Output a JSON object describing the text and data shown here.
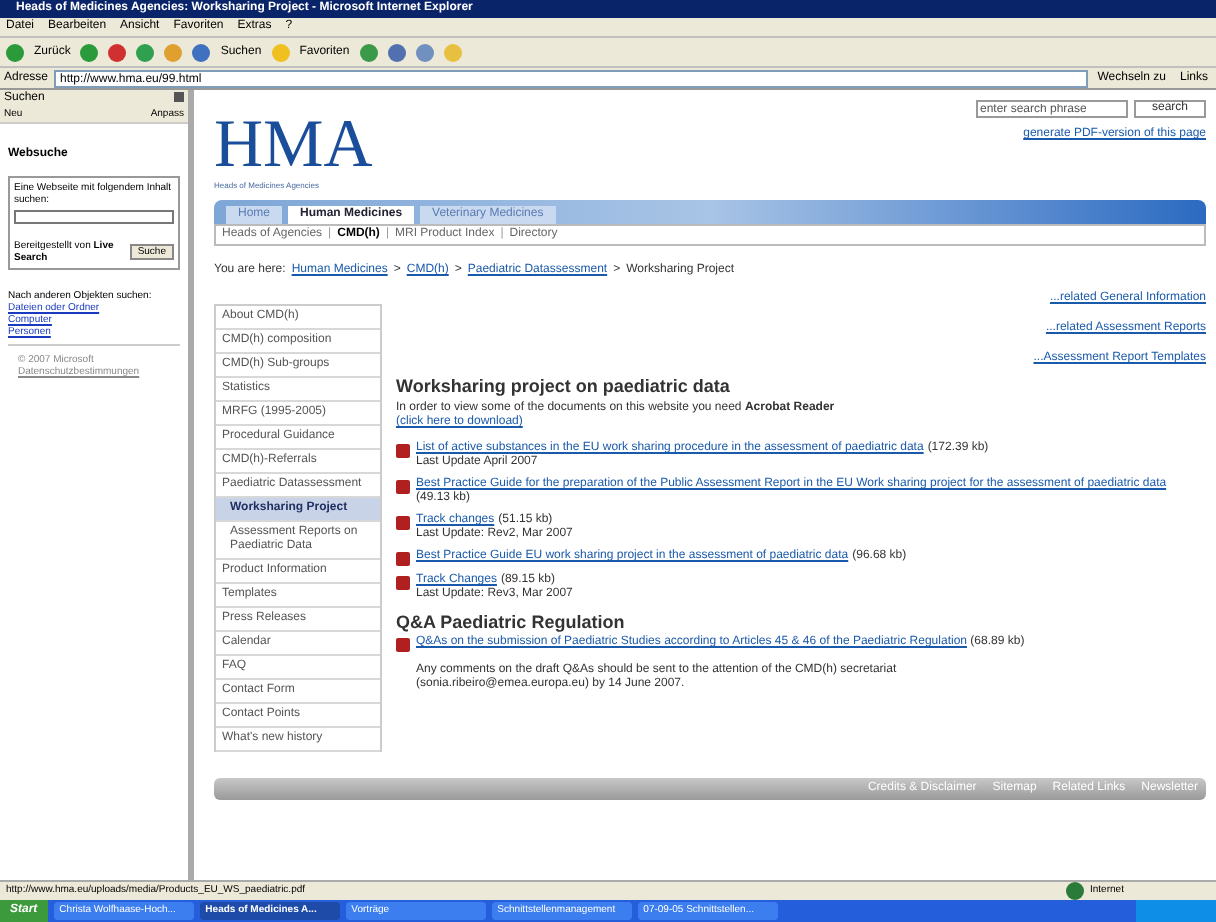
{
  "window": {
    "title": "Heads of Medicines Agencies: Worksharing Project - Microsoft Internet Explorer"
  },
  "menu": [
    "Datei",
    "Bearbeiten",
    "Ansicht",
    "Favoriten",
    "Extras",
    "?"
  ],
  "toolbar": {
    "back": "Zurück",
    "search": "Suchen",
    "favorites": "Favoriten"
  },
  "address": {
    "label": "Adresse",
    "url": "http://www.hma.eu/99.html",
    "go": "Wechseln zu",
    "links": "Links"
  },
  "search_pane": {
    "title": "Suchen",
    "new": "Neu",
    "customize": "Anpass",
    "heading": "Websuche",
    "prompt": "Eine Webseite mit folgendem Inhalt suchen:",
    "provider": "Bereitgestellt von **Live Search**",
    "button": "Suche",
    "other": "Nach anderen Objekten suchen:",
    "links": [
      "Dateien oder Ordner",
      "Computer",
      "Personen"
    ],
    "copyright": "© 2007 Microsoft",
    "privacy": "Datenschutzbestimmungen"
  },
  "page": {
    "logo": "HMA",
    "logo_sub": "Heads of Medicines Agencies",
    "search_placeholder": "enter search phrase",
    "search_button": "search",
    "pdf_link": "generate PDF-version of this page",
    "tabs": [
      {
        "label": "Home",
        "selected": false
      },
      {
        "label": "Human Medicines",
        "selected": true
      },
      {
        "label": "Veterinary Medicines",
        "selected": false
      }
    ],
    "subnav": [
      {
        "label": "Heads of Agencies",
        "selected": false
      },
      {
        "label": "CMD(h)",
        "selected": true
      },
      {
        "label": "MRI Product Index",
        "selected": false
      },
      {
        "label": "Directory",
        "selected": false
      }
    ],
    "subnav_separator": "|",
    "breadcrumb_separator": ">",
    "breadcrumb_label": "You are here:",
    "breadcrumb": [
      "Human Medicines",
      "CMD(h)",
      "Paediatric Datassessment",
      "Worksharing Project"
    ],
    "related": [
      "...related General Information",
      "...related Assessment Reports",
      "...Assessment Report Templates"
    ],
    "sidebar": {
      "items": [
        {
          "label": "About CMD(h)",
          "selected": false
        },
        {
          "label": "CMD(h) composition",
          "selected": false
        },
        {
          "label": "CMD(h) Sub-groups",
          "selected": false
        },
        {
          "label": "Statistics",
          "selected": false
        },
        {
          "label": "MRFG (1995-2005)",
          "selected": false
        },
        {
          "label": "Procedural Guidance",
          "selected": false
        },
        {
          "label": "CMD(h)-Referrals",
          "selected": false
        },
        {
          "label": "Paediatric Datassessment",
          "selected": false,
          "children": [
            {
              "label": "Worksharing Project",
              "selected": true
            },
            {
              "label": "Assessment Reports on Paediatric Data",
              "selected": false
            }
          ]
        },
        {
          "label": "Product Information",
          "selected": false
        },
        {
          "label": "Templates",
          "selected": false
        },
        {
          "label": "Press Releases",
          "selected": false
        },
        {
          "label": "Calendar",
          "selected": false
        },
        {
          "label": "FAQ",
          "selected": false
        },
        {
          "label": "Contact Form",
          "selected": false
        },
        {
          "label": "Contact Points",
          "selected": false
        },
        {
          "label": "What's new history",
          "selected": false
        }
      ]
    },
    "heading": "Worksharing project on paediatric data",
    "intro": "In order to view some of the documents on this website you need **Acrobat Reader**",
    "download": "(click here to download)",
    "documents": [
      {
        "title": "List of active substances in the EU work sharing procedure in the assessment of paediatric data",
        "size": "(172.39 kb)",
        "update": "Last Update April 2007"
      },
      {
        "title": "Best Practice Guide for the preparation of the Public Assessment Report in the EU Work sharing project for the assessment of paediatric data",
        "size": "(49.13 kb)"
      },
      {
        "title": "Track changes",
        "size": "(51.15 kb)",
        "update": "Last Update: Rev2, Mar 2007"
      },
      {
        "title": "Best Practice Guide EU work sharing project in the assessment of paediatric data",
        "size": "(96.68 kb)"
      },
      {
        "title": "Track Changes",
        "size": "(89.15 kb)",
        "update": "Last Update: Rev3, Mar 2007"
      }
    ],
    "qa_heading": "Q&A Paediatric Regulation",
    "qa_documents": [
      {
        "title": "Q&As on the submission of Paediatric Studies according to Articles 45 & 46 of the Paediatric Regulation",
        "size": "(68.89 kb)"
      }
    ],
    "comments": "Any comments on the draft Q&As should be sent to the attention of the CMD(h) secretariat (sonia.ribeiro@emea.europa.eu) by 14 June 2007.",
    "footer": [
      "Credits & Disclaimer",
      "Sitemap",
      "Related Links",
      "Newsletter"
    ]
  },
  "status_bar": {
    "url": "http://www.hma.eu/uploads/media/Products_EU_WS_paediatric.pdf",
    "zone": "Internet"
  },
  "taskbar": {
    "start": "Start",
    "items": [
      {
        "label": "Christa Wolfhaase-Hoch...",
        "selected": false
      },
      {
        "label": "Heads of Medicines A...",
        "selected": true
      },
      {
        "label": "Vorträge",
        "selected": false
      },
      {
        "label": "Schnittstellenmanagement",
        "selected": false
      },
      {
        "label": "07-09-05 Schnittstellen...",
        "selected": false
      }
    ]
  }
}
